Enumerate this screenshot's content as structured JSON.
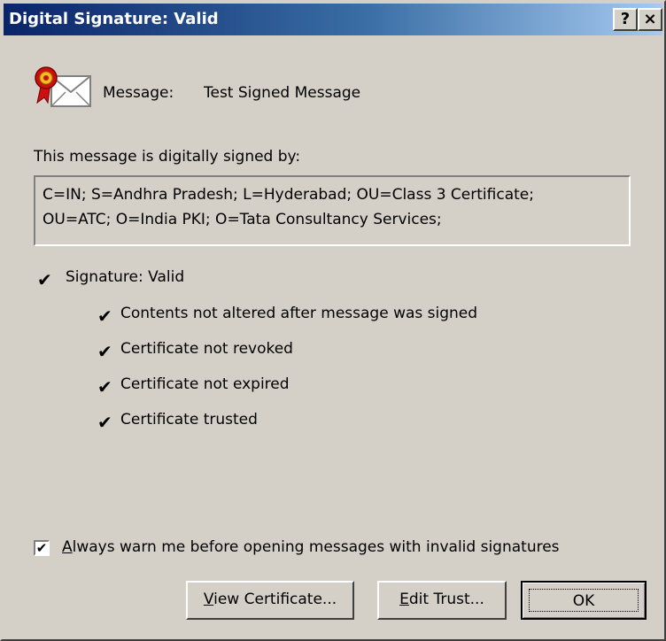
{
  "window": {
    "title": "Digital Signature: Valid",
    "help_glyph": "?",
    "close_glyph": "×"
  },
  "message": {
    "label": "Message:",
    "value": "Test Signed Message",
    "icon": "signed-envelope-icon"
  },
  "signer": {
    "label": "This message is digitally signed by:",
    "line1": "C=IN; S=Andhra Pradesh; L=Hyderabad; OU=Class 3 Certificate;",
    "line2": "OU=ATC; O=India PKI; O=Tata Consultancy Services;"
  },
  "status": {
    "check_glyph": "✔",
    "signature": "Signature: Valid",
    "checks": [
      "Contents not altered after message was signed",
      "Certificate not revoked",
      "Certificate not expired",
      "Certificate trusted"
    ]
  },
  "warn_checkbox": {
    "checked": true,
    "mark": "✔",
    "label_accel": "A",
    "label_rest": "lways warn me before opening messages with invalid signatures"
  },
  "buttons": {
    "view_accel": "V",
    "view_rest": "iew Certificate...",
    "edit_accel": "E",
    "edit_rest": "dit Trust...",
    "ok": "OK"
  },
  "colors": {
    "titlebar_start": "#0a246a",
    "titlebar_end": "#a6caf0",
    "dialog_face": "#d4d0c8",
    "seal_red": "#cc1010",
    "seal_gold": "#f0c020"
  }
}
